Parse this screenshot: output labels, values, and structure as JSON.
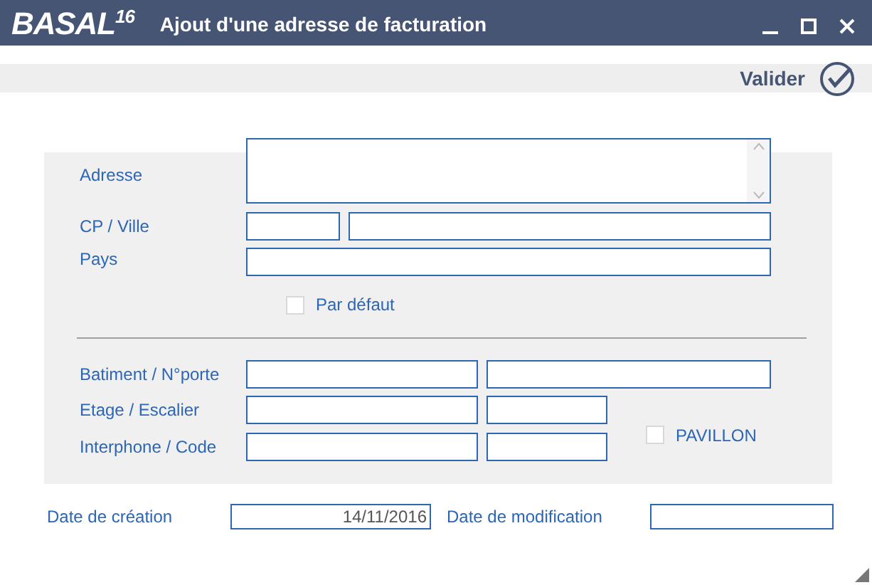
{
  "window": {
    "logo": "BASAL",
    "logo_sup": "16",
    "title": "Ajout d'une adresse de facturation"
  },
  "toolbar": {
    "validate_label": "Valider"
  },
  "address": {
    "label": "Adresse"
  },
  "cp_city": {
    "label": "CP / Ville"
  },
  "country": {
    "label": "Pays"
  },
  "default_checkbox": {
    "label": "Par défaut",
    "checked": false
  },
  "building": {
    "label": "Batiment / N°porte"
  },
  "floor": {
    "label": "Etage / Escalier"
  },
  "intercom": {
    "label": "Interphone / Code"
  },
  "pavilion_checkbox": {
    "label": "PAVILLON",
    "checked": false
  },
  "created": {
    "label": "Date de création",
    "value": "14/11/2016"
  },
  "modified": {
    "label": "Date de modification"
  }
}
